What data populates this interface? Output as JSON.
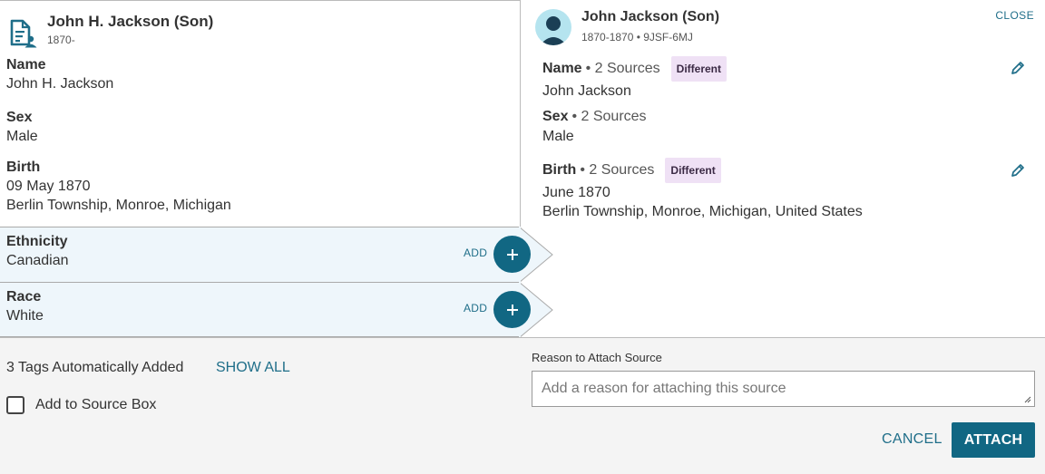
{
  "source": {
    "title": "John H. Jackson (Son)",
    "dates": "1870-",
    "fields": [
      {
        "label": "Name",
        "values": [
          "John H. Jackson"
        ]
      },
      {
        "label": "Sex",
        "values": [
          "Male"
        ]
      },
      {
        "label": "Birth",
        "values": [
          "09 May 1870",
          "Berlin Township, Monroe, Michigan"
        ]
      }
    ],
    "add_rows": [
      {
        "label": "Ethnicity",
        "value": "Canadian",
        "action": "ADD"
      },
      {
        "label": "Race",
        "value": "White",
        "action": "ADD"
      }
    ]
  },
  "person": {
    "title": "John Jackson (Son)",
    "subtitle": "1870-1870 • 9JSF-6MJ",
    "close_label": "CLOSE",
    "fields": [
      {
        "label": "Name",
        "count": "• 2 Sources",
        "badge": "Different",
        "values": [
          "John Jackson"
        ]
      },
      {
        "label": "Sex",
        "count": "• 2 Sources",
        "badge": "",
        "values": [
          "Male"
        ]
      },
      {
        "label": "Birth",
        "count": "• 2 Sources",
        "badge": "Different",
        "values": [
          "June 1870",
          "Berlin Township, Monroe, Michigan, United States"
        ]
      }
    ]
  },
  "footer": {
    "tags_text": "3 Tags Automatically Added",
    "show_all": "SHOW ALL",
    "checkbox_label": "Add to Source Box",
    "reason_label": "Reason to Attach Source",
    "reason_placeholder": "Add a reason for attaching this source",
    "cancel_label": "CANCEL",
    "attach_label": "ATTACH"
  },
  "colors": {
    "accent": "#116783",
    "link": "#1f6e89",
    "badge_bg": "#efe1f5",
    "row_bg": "#eef6fb"
  }
}
